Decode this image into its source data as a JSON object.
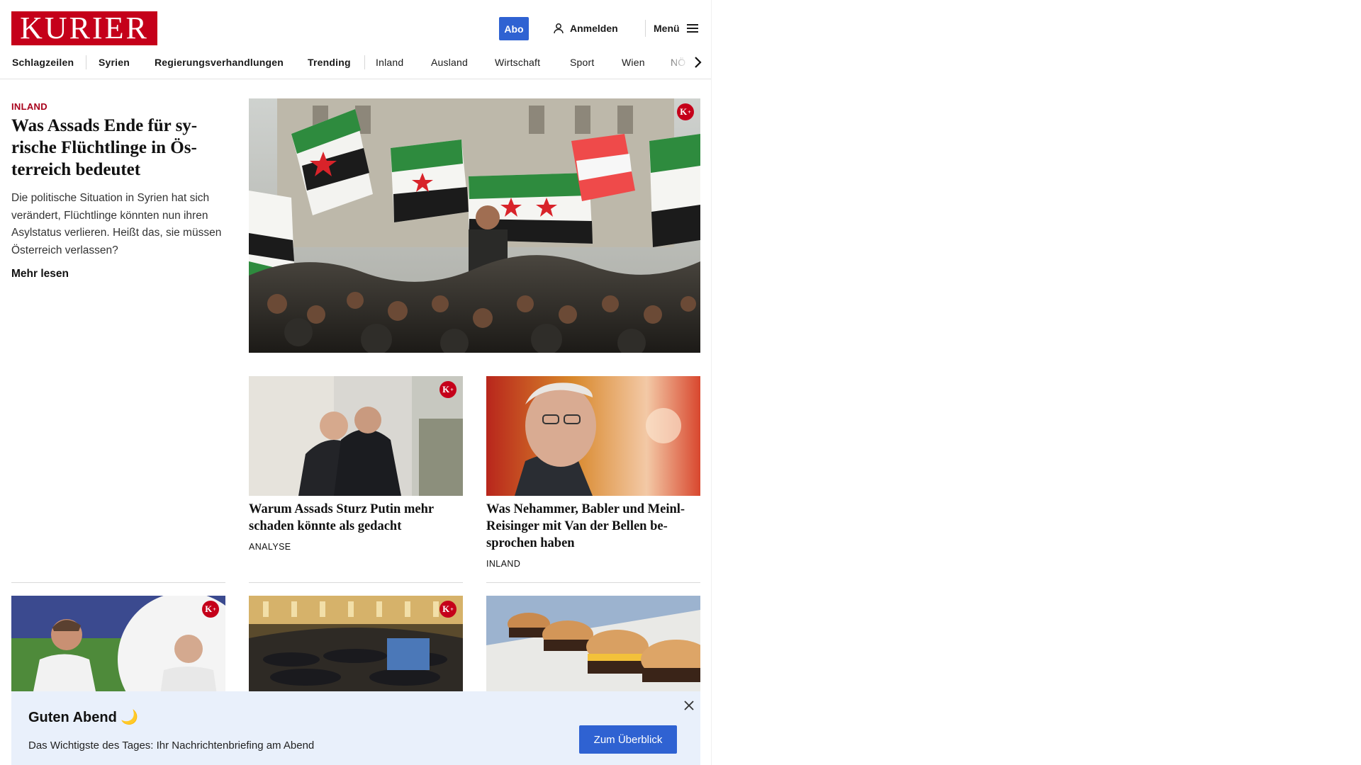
{
  "header": {
    "logo_text": "KURIER",
    "abo_label": "Abo",
    "login_label": "Anmelden",
    "menu_label": "Menü"
  },
  "nav": {
    "items": [
      "Schlagzeilen",
      "Syrien",
      "Regierungsverhandlungen",
      "Trending",
      "Inland",
      "Ausland",
      "Wirtschaft",
      "Sport",
      "Wien",
      "NÖ"
    ]
  },
  "hero": {
    "tag": "INLAND",
    "title": "Was Assads Ende für sy-rische Flüchtlinge in Ös-terreich bedeutet",
    "teaser": "Die politische Situation in Syrien hat sich verändert, Flüchtlinge könnten nun ihren Asylstatus verlieren. Heißt das, sie müssen Österreich verlassen?",
    "more_label": "Mehr lesen",
    "premium_badge": "K+"
  },
  "cards": [
    {
      "title": "Warum Assads Sturz Putin mehr schaden könnte als gedacht",
      "tag": "ANALYSE",
      "premium_badge": "K+"
    },
    {
      "title": "Was Nehammer, Babler und Meinl-Reisinger mit Van der Bellen be-sprochen haben",
      "tag": "INLAND"
    }
  ],
  "thumbs": [
    {
      "premium_badge": "K+"
    },
    {
      "premium_badge": "K+"
    },
    {}
  ],
  "banner": {
    "title": "Guten Abend 🌙",
    "text": "Das Wichtigste des Tages: Ihr Nachrichtenbriefing am Abend",
    "button_label": "Zum Überblick"
  },
  "icons": {
    "user": "user-icon",
    "menu": "hamburger-icon",
    "arrow": "chevron-right-icon",
    "close": "close-icon"
  },
  "colors": {
    "brand_red": "#c5001a",
    "accent_blue": "#2f62d2",
    "banner_bg": "#e9f0fb",
    "tag_red": "#a8001b"
  }
}
